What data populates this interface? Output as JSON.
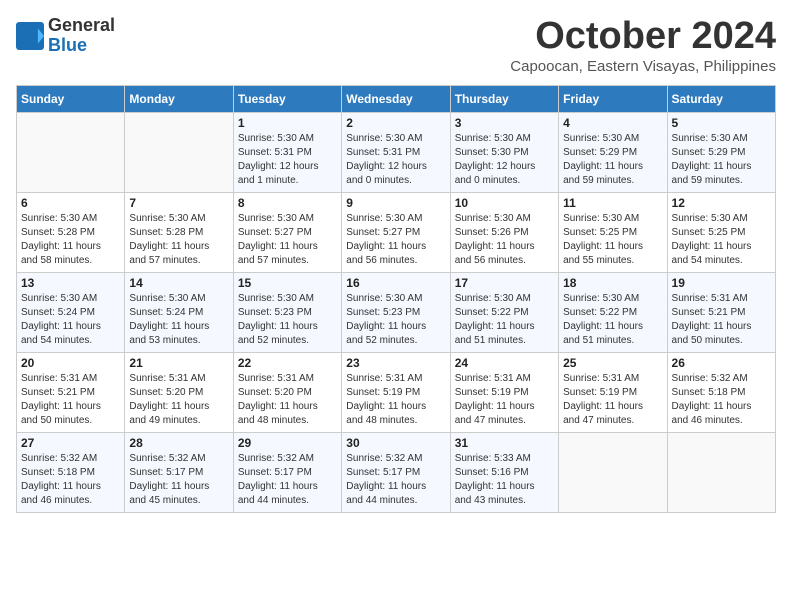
{
  "header": {
    "logo_line1": "General",
    "logo_line2": "Blue",
    "month": "October 2024",
    "location": "Capoocan, Eastern Visayas, Philippines"
  },
  "days_of_week": [
    "Sunday",
    "Monday",
    "Tuesday",
    "Wednesday",
    "Thursday",
    "Friday",
    "Saturday"
  ],
  "weeks": [
    [
      {
        "day": "",
        "info": ""
      },
      {
        "day": "",
        "info": ""
      },
      {
        "day": "1",
        "info": "Sunrise: 5:30 AM\nSunset: 5:31 PM\nDaylight: 12 hours\nand 1 minute."
      },
      {
        "day": "2",
        "info": "Sunrise: 5:30 AM\nSunset: 5:31 PM\nDaylight: 12 hours\nand 0 minutes."
      },
      {
        "day": "3",
        "info": "Sunrise: 5:30 AM\nSunset: 5:30 PM\nDaylight: 12 hours\nand 0 minutes."
      },
      {
        "day": "4",
        "info": "Sunrise: 5:30 AM\nSunset: 5:29 PM\nDaylight: 11 hours\nand 59 minutes."
      },
      {
        "day": "5",
        "info": "Sunrise: 5:30 AM\nSunset: 5:29 PM\nDaylight: 11 hours\nand 59 minutes."
      }
    ],
    [
      {
        "day": "6",
        "info": "Sunrise: 5:30 AM\nSunset: 5:28 PM\nDaylight: 11 hours\nand 58 minutes."
      },
      {
        "day": "7",
        "info": "Sunrise: 5:30 AM\nSunset: 5:28 PM\nDaylight: 11 hours\nand 57 minutes."
      },
      {
        "day": "8",
        "info": "Sunrise: 5:30 AM\nSunset: 5:27 PM\nDaylight: 11 hours\nand 57 minutes."
      },
      {
        "day": "9",
        "info": "Sunrise: 5:30 AM\nSunset: 5:27 PM\nDaylight: 11 hours\nand 56 minutes."
      },
      {
        "day": "10",
        "info": "Sunrise: 5:30 AM\nSunset: 5:26 PM\nDaylight: 11 hours\nand 56 minutes."
      },
      {
        "day": "11",
        "info": "Sunrise: 5:30 AM\nSunset: 5:25 PM\nDaylight: 11 hours\nand 55 minutes."
      },
      {
        "day": "12",
        "info": "Sunrise: 5:30 AM\nSunset: 5:25 PM\nDaylight: 11 hours\nand 54 minutes."
      }
    ],
    [
      {
        "day": "13",
        "info": "Sunrise: 5:30 AM\nSunset: 5:24 PM\nDaylight: 11 hours\nand 54 minutes."
      },
      {
        "day": "14",
        "info": "Sunrise: 5:30 AM\nSunset: 5:24 PM\nDaylight: 11 hours\nand 53 minutes."
      },
      {
        "day": "15",
        "info": "Sunrise: 5:30 AM\nSunset: 5:23 PM\nDaylight: 11 hours\nand 52 minutes."
      },
      {
        "day": "16",
        "info": "Sunrise: 5:30 AM\nSunset: 5:23 PM\nDaylight: 11 hours\nand 52 minutes."
      },
      {
        "day": "17",
        "info": "Sunrise: 5:30 AM\nSunset: 5:22 PM\nDaylight: 11 hours\nand 51 minutes."
      },
      {
        "day": "18",
        "info": "Sunrise: 5:30 AM\nSunset: 5:22 PM\nDaylight: 11 hours\nand 51 minutes."
      },
      {
        "day": "19",
        "info": "Sunrise: 5:31 AM\nSunset: 5:21 PM\nDaylight: 11 hours\nand 50 minutes."
      }
    ],
    [
      {
        "day": "20",
        "info": "Sunrise: 5:31 AM\nSunset: 5:21 PM\nDaylight: 11 hours\nand 50 minutes."
      },
      {
        "day": "21",
        "info": "Sunrise: 5:31 AM\nSunset: 5:20 PM\nDaylight: 11 hours\nand 49 minutes."
      },
      {
        "day": "22",
        "info": "Sunrise: 5:31 AM\nSunset: 5:20 PM\nDaylight: 11 hours\nand 48 minutes."
      },
      {
        "day": "23",
        "info": "Sunrise: 5:31 AM\nSunset: 5:19 PM\nDaylight: 11 hours\nand 48 minutes."
      },
      {
        "day": "24",
        "info": "Sunrise: 5:31 AM\nSunset: 5:19 PM\nDaylight: 11 hours\nand 47 minutes."
      },
      {
        "day": "25",
        "info": "Sunrise: 5:31 AM\nSunset: 5:19 PM\nDaylight: 11 hours\nand 47 minutes."
      },
      {
        "day": "26",
        "info": "Sunrise: 5:32 AM\nSunset: 5:18 PM\nDaylight: 11 hours\nand 46 minutes."
      }
    ],
    [
      {
        "day": "27",
        "info": "Sunrise: 5:32 AM\nSunset: 5:18 PM\nDaylight: 11 hours\nand 46 minutes."
      },
      {
        "day": "28",
        "info": "Sunrise: 5:32 AM\nSunset: 5:17 PM\nDaylight: 11 hours\nand 45 minutes."
      },
      {
        "day": "29",
        "info": "Sunrise: 5:32 AM\nSunset: 5:17 PM\nDaylight: 11 hours\nand 44 minutes."
      },
      {
        "day": "30",
        "info": "Sunrise: 5:32 AM\nSunset: 5:17 PM\nDaylight: 11 hours\nand 44 minutes."
      },
      {
        "day": "31",
        "info": "Sunrise: 5:33 AM\nSunset: 5:16 PM\nDaylight: 11 hours\nand 43 minutes."
      },
      {
        "day": "",
        "info": ""
      },
      {
        "day": "",
        "info": ""
      }
    ]
  ]
}
